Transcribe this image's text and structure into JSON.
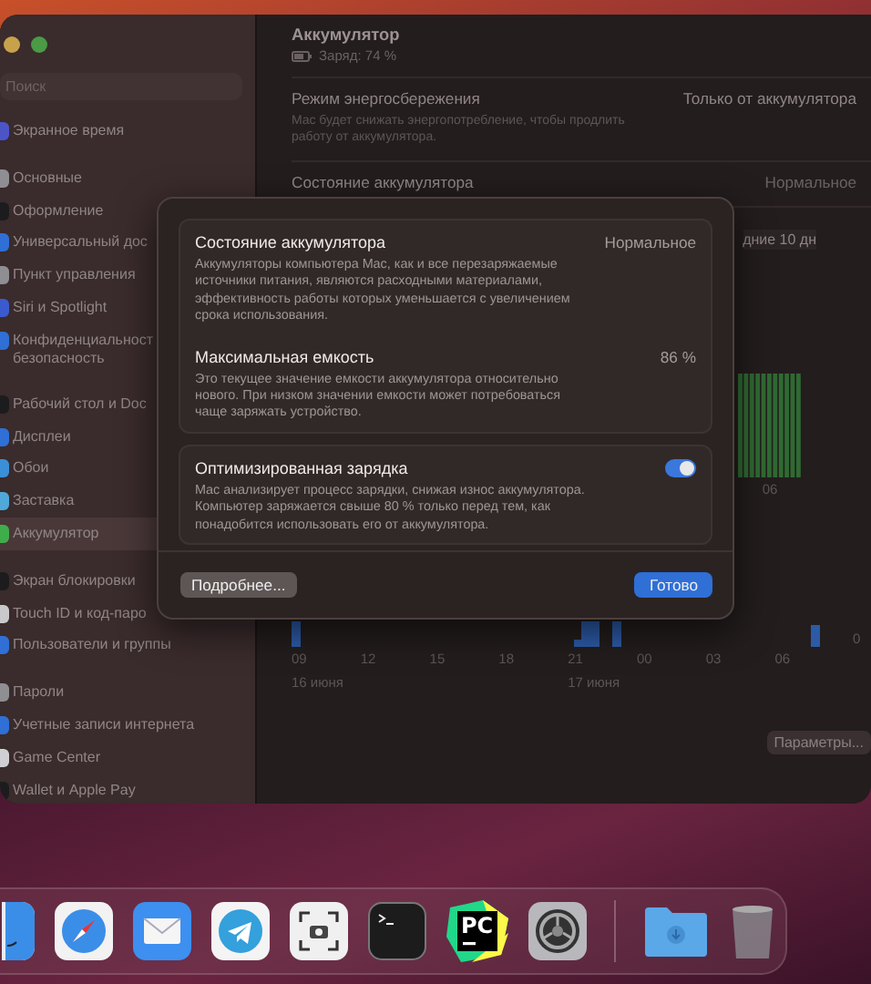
{
  "sidebar": {
    "search": {
      "placeholder": "Поиск"
    },
    "groups": [
      [
        {
          "label": "Экранное время",
          "color": "#4c55c8",
          "selected": false
        }
      ],
      [
        {
          "label": "Основные",
          "color": "#8e8e93",
          "selected": false
        },
        {
          "label": "Оформление",
          "color": "#1c1c1e",
          "selected": false
        },
        {
          "label": "Универсальный дос",
          "color": "#2f6fd6",
          "selected": false
        },
        {
          "label": "Пункт управления",
          "color": "#8e8e93",
          "selected": false
        },
        {
          "label": "Siri и Spotlight",
          "color": "#3a5bd0",
          "selected": false
        },
        {
          "label": "Конфиденциальност безопасность",
          "color": "#2f6fd6",
          "selected": false
        }
      ],
      [
        {
          "label": "Рабочий стол и Doc",
          "color": "#1c1c1e",
          "selected": false
        },
        {
          "label": "Дисплеи",
          "color": "#2f6fd6",
          "selected": false
        },
        {
          "label": "Обои",
          "color": "#3a8fd8",
          "selected": false
        },
        {
          "label": "Заставка",
          "color": "#4fa8d8",
          "selected": false
        },
        {
          "label": "Аккумулятор",
          "color": "#3fae4a",
          "selected": true
        }
      ],
      [
        {
          "label": "Экран блокировки",
          "color": "#1c1c1e",
          "selected": false
        },
        {
          "label": "Touch ID и код-паро",
          "color": "#c9c9cc",
          "selected": false
        },
        {
          "label": "Пользователи и группы",
          "color": "#2f6fd6",
          "selected": false
        }
      ],
      [
        {
          "label": "Пароли",
          "color": "#8e8e93",
          "selected": false
        },
        {
          "label": "Учетные записи интернета",
          "color": "#2f6fd6",
          "selected": false
        },
        {
          "label": "Game Center",
          "color": "#d0d0d4",
          "selected": false
        },
        {
          "label": "Wallet и Apple Pay",
          "color": "#1c1c1e",
          "selected": false
        }
      ]
    ]
  },
  "main": {
    "title": "Аккумулятор",
    "charge": "Заряд: 74 %",
    "rows": [
      {
        "label": "Режим энергосбережения",
        "description": "Mac будет снижать энергопотребление, чтобы продлить работу от аккумулятора.",
        "value": "Только от аккумулятора"
      },
      {
        "label": "Состояние аккумулятора",
        "value": "Нормальное"
      }
    ],
    "period_tab": "дние 10 дн",
    "level_chart": {
      "tick": "06"
    },
    "usage_chart": {
      "ticks": [
        "09",
        "12",
        "15",
        "18",
        "21",
        "00",
        "03",
        "06"
      ],
      "dates": [
        "16 июня",
        "17 июня"
      ],
      "axis_label": "0"
    },
    "settings_button": "Параметры..."
  },
  "dialog": {
    "sections": [
      {
        "items": [
          {
            "kind": "value",
            "title": "Состояние аккумулятора",
            "value": "Нормальное",
            "description": "Аккумуляторы компьютера Mac, как и все перезаряжаемые источники питания, являются расходными материалами, эффективность работы которых уменьшается с увеличением срока использования."
          },
          {
            "kind": "value",
            "title": "Максимальная емкость",
            "value": "86 %",
            "description": "Это текущее значение емкости аккумулятора относительно нового. При низком значении емкости может потребоваться чаще заряжать устройство."
          }
        ]
      },
      {
        "items": [
          {
            "kind": "toggle",
            "title": "Оптимизированная зарядка",
            "on": true,
            "description": "Mac анализирует процесс зарядки, снижая износ аккумулятора. Компьютер заряжается свыше 80 % только перед тем, как понадобится использовать его от аккумулятора."
          }
        ]
      }
    ],
    "buttons": [
      {
        "label": "Подробнее...",
        "kind": "secondary"
      },
      {
        "label": "Готово",
        "kind": "primary"
      }
    ]
  },
  "dock": {
    "items": [
      {
        "kind": "finder"
      },
      {
        "kind": "safari"
      },
      {
        "kind": "mail"
      },
      {
        "kind": "telegram"
      },
      {
        "kind": "screenshot"
      },
      {
        "kind": "terminal"
      },
      {
        "kind": "pycharm",
        "label": "PC"
      },
      {
        "kind": "settings"
      },
      {
        "kind": "separator"
      },
      {
        "kind": "downloads"
      },
      {
        "kind": "trash"
      }
    ]
  }
}
